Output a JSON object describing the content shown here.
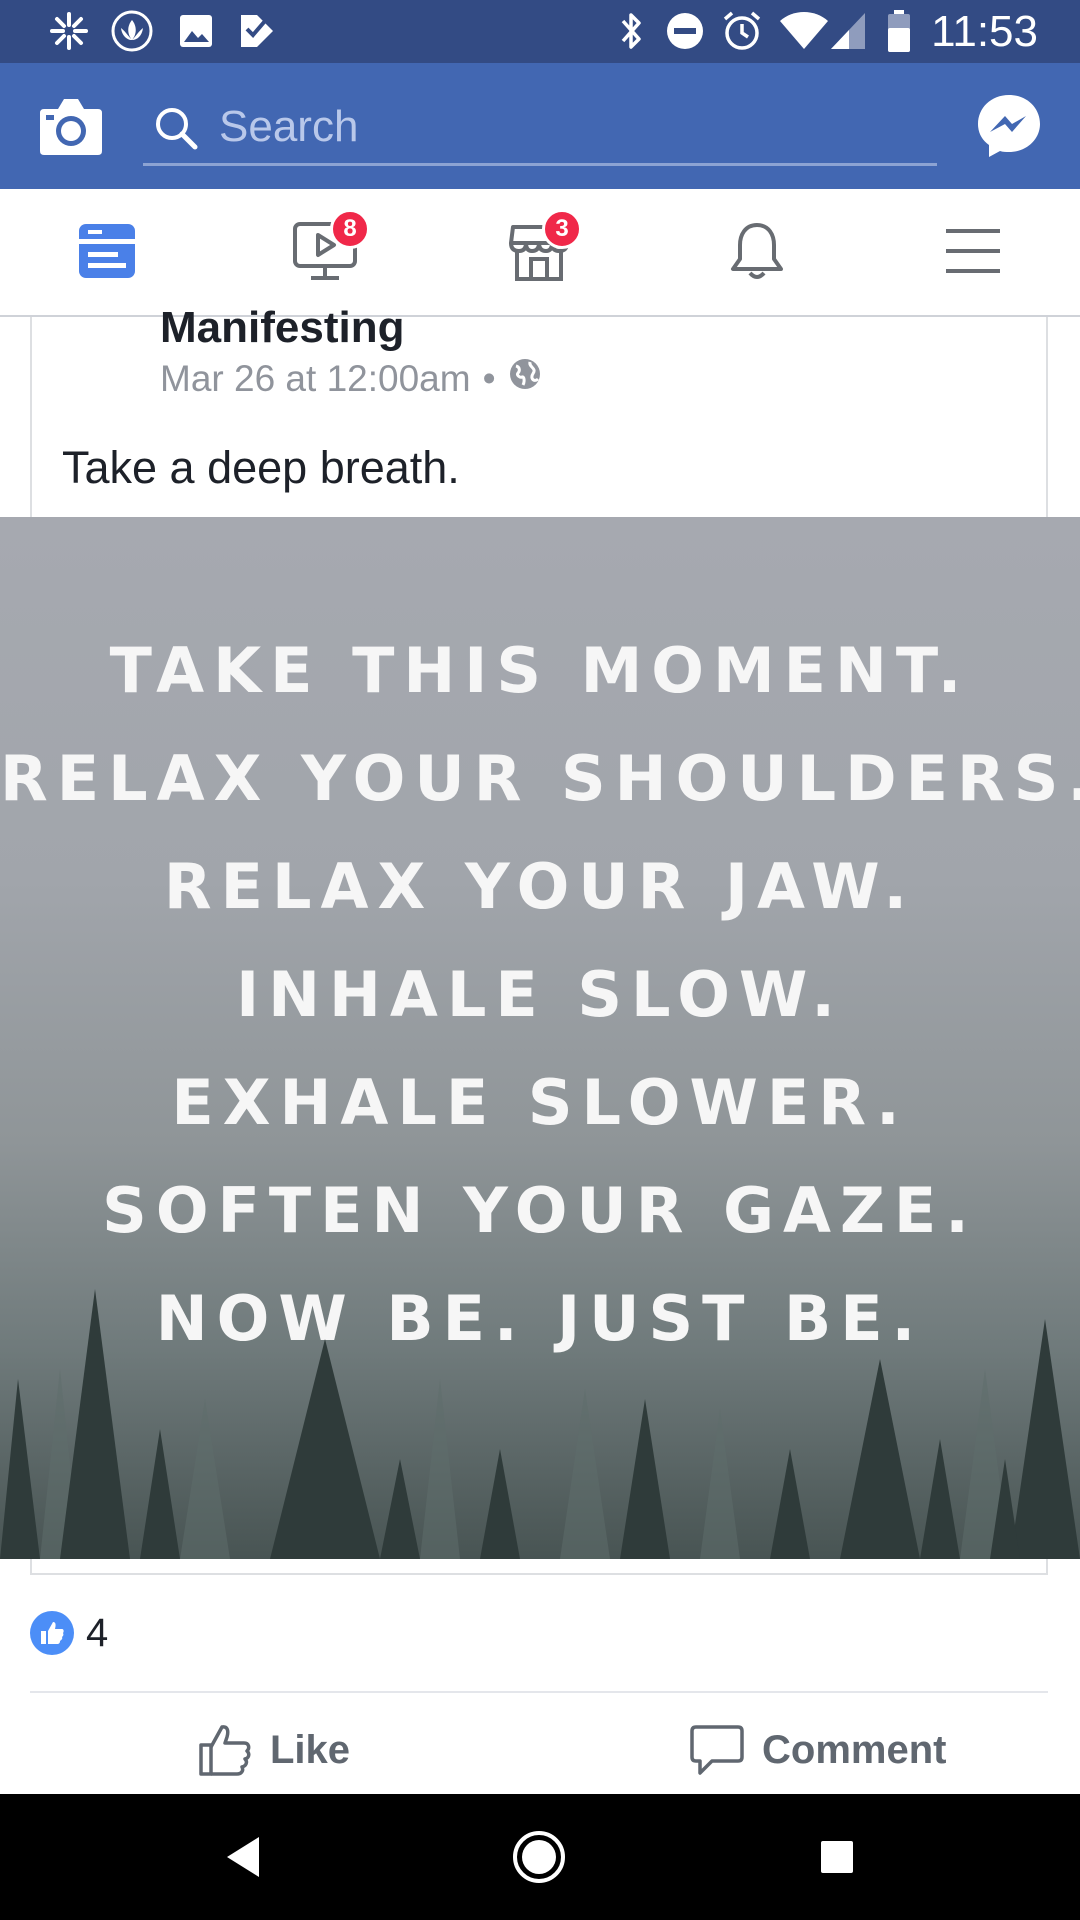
{
  "status_bar": {
    "time": "11:53",
    "left_icons": [
      "asterisk-notification-icon",
      "lotus-app-icon",
      "gallery-icon",
      "checklist-icon"
    ],
    "right_icons": [
      "bluetooth-icon",
      "do-not-disturb-icon",
      "alarm-icon",
      "wifi-icon",
      "cell-signal-icon",
      "battery-icon"
    ]
  },
  "app_bar": {
    "search_placeholder": "Search",
    "icons": [
      "camera-icon",
      "search-icon",
      "messenger-icon"
    ]
  },
  "tabs": [
    {
      "name": "news-feed",
      "icon": "news-feed-icon",
      "active": true,
      "badge": ""
    },
    {
      "name": "watch",
      "icon": "watch-video-icon",
      "active": false,
      "badge": "8"
    },
    {
      "name": "marketplace",
      "icon": "marketplace-icon",
      "active": false,
      "badge": "3"
    },
    {
      "name": "notifications",
      "icon": "bell-icon",
      "active": false,
      "badge": ""
    },
    {
      "name": "menu",
      "icon": "hamburger-menu-icon",
      "active": false,
      "badge": ""
    }
  ],
  "post": {
    "author": "Manifesting",
    "timestamp": "Mar 26 at 12:00am",
    "separator": "•",
    "privacy_icon": "globe-icon",
    "text": "Take a deep breath.",
    "image_lines": [
      "TAKE THIS MOMENT.",
      "RELAX YOUR SHOULDERS.",
      "RELAX YOUR JAW.",
      "INHALE SLOW.",
      "EXHALE SLOWER.",
      "SOFTEN YOUR GAZE.",
      "NOW BE. JUST BE."
    ],
    "reaction_count": "4",
    "actions": {
      "like": "Like",
      "comment": "Comment"
    }
  },
  "nav_bar": {
    "icons": [
      "back-icon",
      "home-icon",
      "recents-icon"
    ]
  },
  "colors": {
    "status_bar": "#334b84",
    "app_bar": "#4267b2",
    "active_tab": "#4a80e8",
    "inactive_tab": "#686c72",
    "badge": "#f02849",
    "like_blue": "#4c8ef7"
  }
}
